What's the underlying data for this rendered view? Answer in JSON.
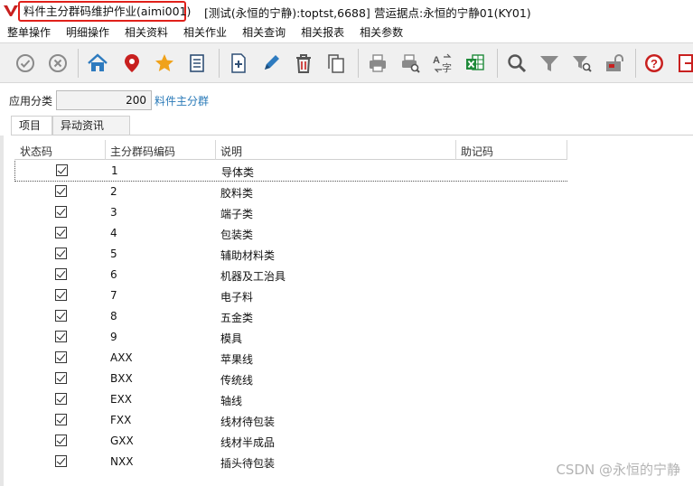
{
  "window": {
    "title": "料件主分群码维护作业(aimi001)",
    "environment": "[测试(永恒的宁静):toptst,6688]",
    "site": "营运据点:永恒的宁静01(KY01)"
  },
  "menu": [
    "整单操作",
    "明细操作",
    "相关资料",
    "相关作业",
    "相关查询",
    "相关报表",
    "相关参数"
  ],
  "toolbar": {
    "buttons": [
      "check-circle-icon",
      "cancel-circle-icon",
      "home-icon",
      "location-pin-icon",
      "favorite-star-icon",
      "list-document-icon",
      "add-new-icon",
      "edit-pencil-icon",
      "delete-trash-icon",
      "copy-icon",
      "print-icon",
      "print-preview-icon",
      "translate-icon",
      "excel-export-icon",
      "search-icon",
      "filter-icon",
      "filter-search-icon",
      "lock-icon",
      "help-icon",
      "exit-icon"
    ],
    "colors": {
      "home": "#2e7bbf",
      "pin": "#c8201f",
      "star": "#f0a21a",
      "excel": "#1f8a3a",
      "help": "#c8201f"
    }
  },
  "category": {
    "label": "应用分类",
    "value": "200",
    "link": "料件主分群"
  },
  "tabs": [
    "项目",
    "异动资讯"
  ],
  "grid": {
    "columns": [
      "状态码",
      "主分群码编码",
      "说明",
      "助记码"
    ],
    "rows": [
      {
        "status": true,
        "code": "1",
        "desc": "导体类"
      },
      {
        "status": true,
        "code": "2",
        "desc": "胶料类"
      },
      {
        "status": true,
        "code": "3",
        "desc": "端子类"
      },
      {
        "status": true,
        "code": "4",
        "desc": "包装类"
      },
      {
        "status": true,
        "code": "5",
        "desc": "辅助材料类"
      },
      {
        "status": true,
        "code": "6",
        "desc": "机器及工治具"
      },
      {
        "status": true,
        "code": "7",
        "desc": "电子料"
      },
      {
        "status": true,
        "code": "8",
        "desc": "五金类"
      },
      {
        "status": true,
        "code": "9",
        "desc": "模具"
      },
      {
        "status": true,
        "code": "AXX",
        "desc": "苹果线"
      },
      {
        "status": true,
        "code": "BXX",
        "desc": "传统线"
      },
      {
        "status": true,
        "code": "EXX",
        "desc": "轴线"
      },
      {
        "status": true,
        "code": "FXX",
        "desc": "线材待包装"
      },
      {
        "status": true,
        "code": "GXX",
        "desc": "线材半成品"
      },
      {
        "status": true,
        "code": "NXX",
        "desc": "插头待包装"
      }
    ]
  },
  "watermark": "CSDN @永恒的宁静"
}
